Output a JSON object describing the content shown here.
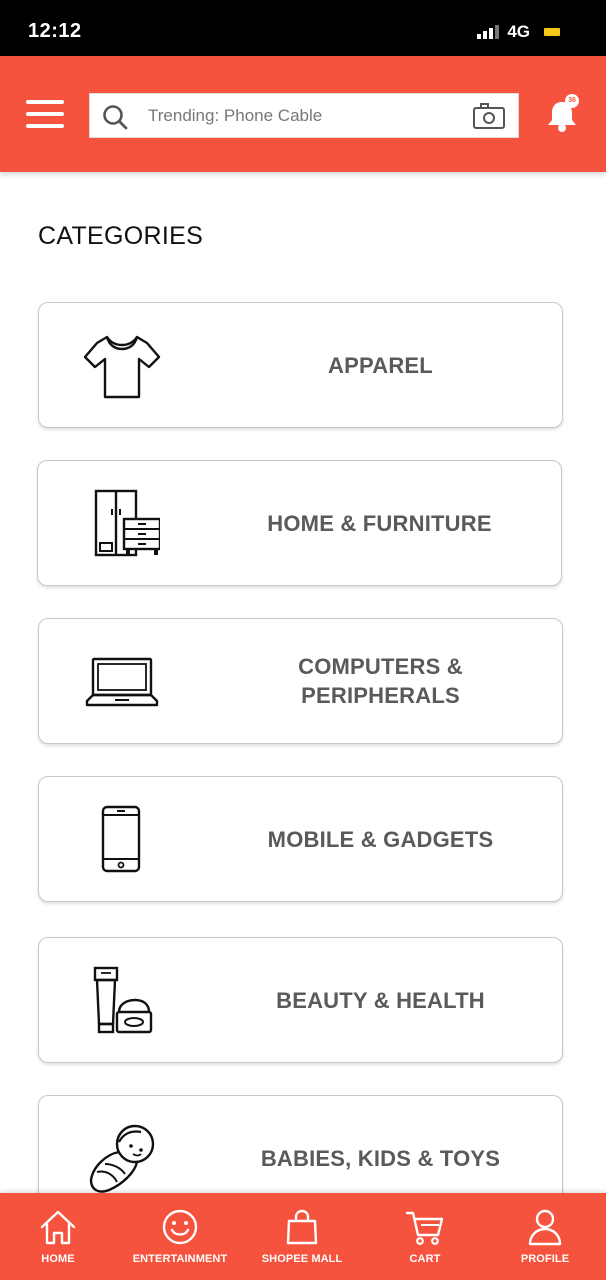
{
  "status_bar": {
    "time": "12:12",
    "network": "4G"
  },
  "header": {
    "search_placeholder": "Trending: Phone Cable",
    "notification_count": "36"
  },
  "section_title": "CATEGORIES",
  "categories": [
    {
      "label": "APPAREL",
      "icon": "tshirt-icon"
    },
    {
      "label": "HOME & FURNITURE",
      "icon": "furniture-icon"
    },
    {
      "label": "COMPUTERS &\nPERIPHERALS",
      "icon": "laptop-icon"
    },
    {
      "label": "MOBILE & GADGETS",
      "icon": "smartphone-icon"
    },
    {
      "label": "BEAUTY & HEALTH",
      "icon": "cosmetics-icon"
    },
    {
      "label": "BABIES, KIDS & TOYS",
      "icon": "baby-icon"
    }
  ],
  "bottom_nav": [
    {
      "label": "HOME",
      "icon": "home-icon"
    },
    {
      "label": "ENTERTAINMENT",
      "icon": "smiley-icon"
    },
    {
      "label": "SHOPEE MALL",
      "icon": "shopping-bag-icon"
    },
    {
      "label": "CART",
      "icon": "cart-icon"
    },
    {
      "label": "PROFILE",
      "icon": "profile-icon"
    }
  ],
  "colors": {
    "brand": "#f5533d",
    "label_gray": "#5a5a5a",
    "status_bar": "#000000"
  }
}
